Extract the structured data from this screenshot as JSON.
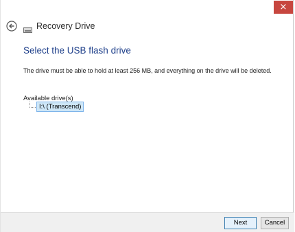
{
  "window": {
    "title": "Recovery Drive",
    "close_glyph": "×",
    "accent_close": "#c7463f"
  },
  "nav": {
    "back_icon": "back-arrow-icon",
    "app_icon": "drive-icon"
  },
  "main": {
    "heading": "Select the USB flash drive",
    "description": "The drive must be able to hold at least 256 MB, and everything on the drive will be deleted.",
    "drives_label": "Available drive(s)",
    "drives": [
      {
        "label": "I:\\ (Transcend)",
        "selected": true
      }
    ]
  },
  "footer": {
    "next_label": "Next",
    "cancel_label": "Cancel"
  }
}
